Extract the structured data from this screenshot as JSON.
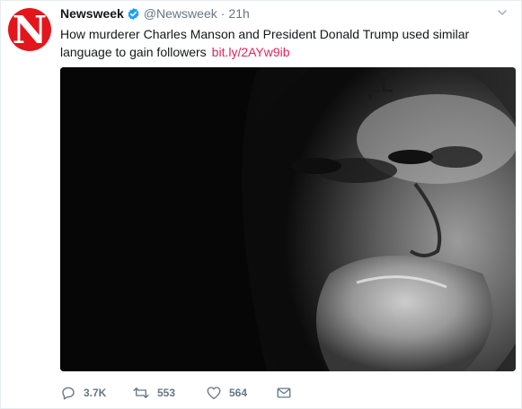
{
  "tweet": {
    "avatar_letter": "N",
    "display_name": "Newsweek",
    "verified_icon": "verified-badge-icon",
    "handle": "@Newsweek",
    "separator": "·",
    "timestamp": "21h",
    "text": "How murderer Charles Manson and President Donald Trump used similar language to gain followers",
    "link": "bit.ly/2AYw9ib",
    "colors": {
      "brand_red": "#e3161b",
      "link": "#e0245e",
      "muted": "#657786",
      "verified": "#1da1f2"
    }
  },
  "actions": {
    "reply": {
      "icon": "reply-icon",
      "count": "3.7K"
    },
    "retweet": {
      "icon": "retweet-icon",
      "count": "553"
    },
    "like": {
      "icon": "heart-icon",
      "count": "564"
    },
    "message": {
      "icon": "envelope-icon"
    }
  }
}
